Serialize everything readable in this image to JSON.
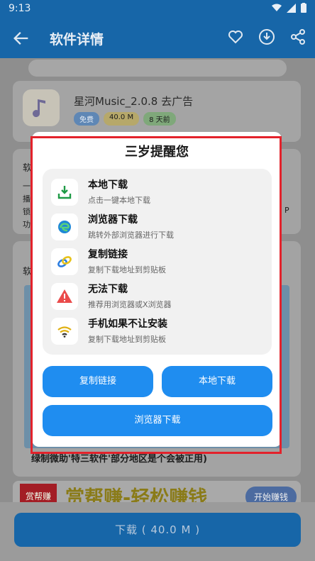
{
  "status": {
    "time": "9:13"
  },
  "appbar": {
    "title": "软件详情"
  },
  "app": {
    "name": "星河Music_2.0.8 去广告",
    "tags": [
      "免费",
      "40.0 M",
      "8 天前"
    ]
  },
  "background": {
    "section1_frag": "软",
    "section1_lines": [
      "一",
      "播",
      "锁",
      "功"
    ],
    "section1_right": "P",
    "section2_frag": "软",
    "caption": "绿制微助'特三软件'部分地区是个会被正用)",
    "ad_logo": "赏帮赚",
    "ad_text": "赏帮赚-轻松赚钱",
    "ad_button": "开始赚钱"
  },
  "bottom": {
    "download_label": "下载 ( 40.0 M )"
  },
  "dialog": {
    "title": "三岁提醒您",
    "options": [
      {
        "name": "本地下载",
        "sub": "点击一键本地下载",
        "icon": "download-arrow-icon"
      },
      {
        "name": "浏览器下载",
        "sub": "跳转外部浏览器进行下载",
        "icon": "edge-browser-icon"
      },
      {
        "name": "复制链接",
        "sub": "复制下载地址到剪贴板",
        "icon": "link-icon"
      },
      {
        "name": "无法下载",
        "sub": "推荐用浏览器或X浏览器",
        "icon": "warning-icon"
      },
      {
        "name": "手机如果不让安装",
        "sub": "复制下载地址到剪贴板",
        "icon": "wifi-icon"
      }
    ],
    "btn_copy": "复制链接",
    "btn_local": "本地下载",
    "btn_browser": "浏览器下载"
  },
  "colors": {
    "primary": "#1f8df0",
    "highlight": "#e3222b",
    "appbar": "#1766a8"
  }
}
